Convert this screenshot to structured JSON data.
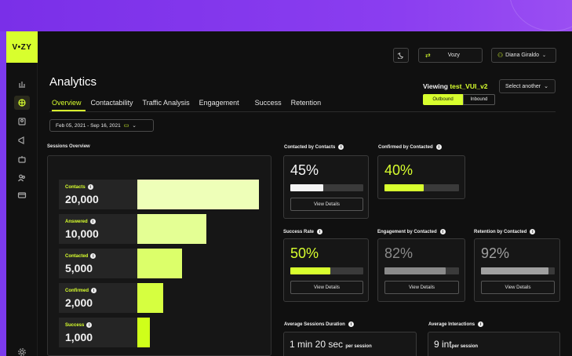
{
  "app": {
    "logo": "V•ZY"
  },
  "topbar": {
    "project_name": "Vozy",
    "user_name": "Diana Giraldo"
  },
  "page": {
    "title": "Analytics",
    "tabs": [
      "Overview",
      "Contactability",
      "Traffic Analysis",
      "Engagement",
      "Success",
      "Retention"
    ],
    "active_tab": "Overview"
  },
  "viewing": {
    "label": "Viewing",
    "name": "test_VUI_v2",
    "select_another": "Select another",
    "segments": [
      "Outbound",
      "Inbound"
    ],
    "active_segment": "Outbound"
  },
  "date_range": "Feb 05, 2021 - Sep 16, 2021",
  "sessions_overview": {
    "label": "Sessions Overview",
    "funnel": [
      {
        "name": "Contacts",
        "value": "20,000",
        "fraction": 1.0,
        "color": "#eeffb8"
      },
      {
        "name": "Answered",
        "value": "10,000",
        "fraction": 0.57,
        "color": "#e4ff94"
      },
      {
        "name": "Contacted",
        "value": "5,000",
        "fraction": 0.37,
        "color": "#dcff6a"
      },
      {
        "name": "Confirmed",
        "value": "2,000",
        "fraction": 0.21,
        "color": "#d6ff40"
      },
      {
        "name": "Success",
        "value": "1,000",
        "fraction": 0.1,
        "color": "#cfff1a"
      }
    ]
  },
  "cards": {
    "contacted_by_contacts": {
      "label": "Contacted by Contacts",
      "value": "45%",
      "fraction": 0.45,
      "color": "#f5f5f5",
      "button": "View Details"
    },
    "confirmed_by_contacted": {
      "label": "Confirmed by Contacted",
      "value": "40%",
      "fraction": 0.53,
      "color": "#d8ff2e",
      "button": "View Details"
    },
    "success_rate": {
      "label": "Success Rate",
      "value": "50%",
      "fraction": 0.55,
      "color": "#d8ff2e",
      "button": "View Details"
    },
    "engagement_by_contacted": {
      "label": "Engagement by Contacted",
      "value": "82%",
      "fraction": 0.82,
      "color": "#8a8a8a",
      "button": "View Details"
    },
    "retention_by_contacted": {
      "label": "Retention by Contacted",
      "value": "92%",
      "fraction": 0.92,
      "color": "#a0a0a0",
      "button": "View Details"
    }
  },
  "averages": {
    "sessions_duration": {
      "label": "Average Sessions Duration",
      "value": "1 min 20 sec",
      "unit": "per session"
    },
    "interactions": {
      "label": "Average Interactions",
      "value": "9 int",
      "unit": "per session"
    }
  },
  "colors": {
    "accent": "#d8ff2e",
    "background": "#101010",
    "frame": "#7c3aed"
  }
}
